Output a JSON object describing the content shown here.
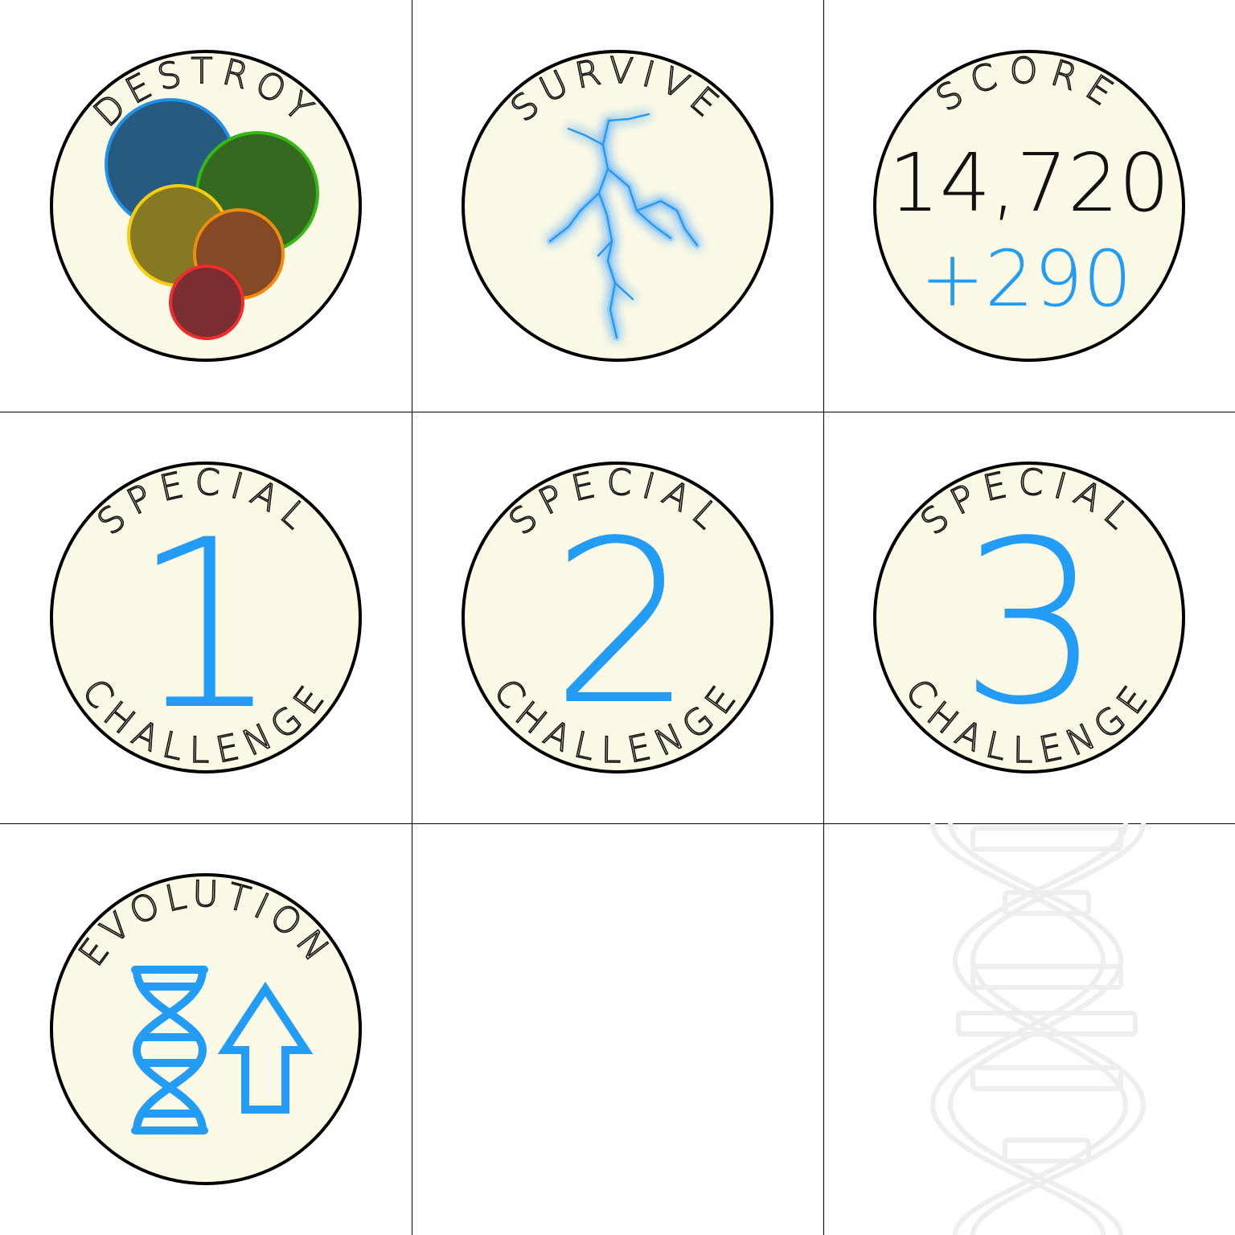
{
  "colors": {
    "badge_fill": "#fcf9e6",
    "badge_stroke": "#000000",
    "accent_blue": "#229cf5",
    "grid_line": "#000000"
  },
  "badges": [
    {
      "id": "destroy",
      "label": "DESTROY",
      "icon": "colored-circles-icon",
      "circle_colors": [
        {
          "fill": "#275a80",
          "stroke": "#1f92e8"
        },
        {
          "fill": "#34691f",
          "stroke": "#34b814"
        },
        {
          "fill": "#857a23",
          "stroke": "#f7cc0a"
        },
        {
          "fill": "#844a25",
          "stroke": "#f28b0e"
        },
        {
          "fill": "#7b2e31",
          "stroke": "#f22c2c"
        }
      ]
    },
    {
      "id": "survive",
      "label": "SURVIVE",
      "icon": "lightning-icon"
    },
    {
      "id": "score",
      "label": "SCORE",
      "score": "14,720",
      "bonus": "+290"
    },
    {
      "id": "special-1",
      "label_top": "SPECIAL",
      "label_bottom": "CHALLENGE",
      "number": "1"
    },
    {
      "id": "special-2",
      "label_top": "SPECIAL",
      "label_bottom": "CHALLENGE",
      "number": "2"
    },
    {
      "id": "special-3",
      "label_top": "SPECIAL",
      "label_bottom": "CHALLENGE",
      "number": "3"
    },
    {
      "id": "evolution",
      "label": "EVOLUTION",
      "icons": [
        "dna-icon",
        "arrow-up-icon"
      ]
    }
  ],
  "empty_cells": [
    "blank-cell",
    "white-dna-watermark-icon"
  ]
}
